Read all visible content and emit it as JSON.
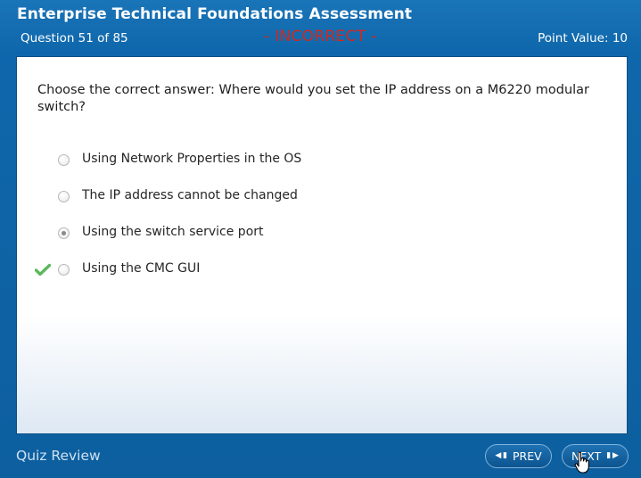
{
  "header": {
    "title": "Enterprise Technical Foundations Assessment",
    "question_counter": "Question 51 of 85",
    "status": "- INCORRECT -",
    "point_value": "Point Value:  10"
  },
  "question": {
    "text": "Choose the correct answer: Where would you set the IP address on a M6220 modular switch?",
    "answers": [
      {
        "label": "Using Network Properties in the OS",
        "selected": false,
        "correct": false
      },
      {
        "label": "The IP address cannot be changed",
        "selected": false,
        "correct": false
      },
      {
        "label": "Using the switch service port",
        "selected": true,
        "correct": false
      },
      {
        "label": "Using the CMC GUI",
        "selected": false,
        "correct": true
      }
    ]
  },
  "footer": {
    "quiz_review": "Quiz Review",
    "prev_label": "PREV",
    "next_label": "NEXT"
  },
  "colors": {
    "header_blue": "#0f63a3",
    "incorrect_red": "#d2281f",
    "check_green": "#5cb85c"
  },
  "icons": {
    "correct": "checkmark-icon",
    "prev": "prev-arrow-icon",
    "next": "next-arrow-icon",
    "cursor": "hand-cursor-icon"
  }
}
